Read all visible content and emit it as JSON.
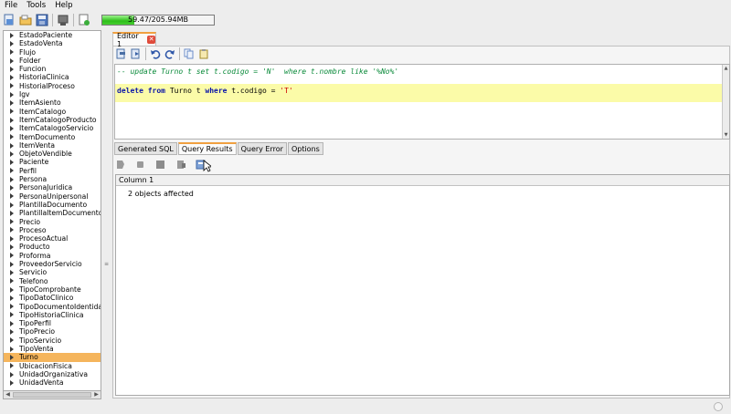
{
  "menu": [
    "File",
    "Tools",
    "Help"
  ],
  "toolbar": {
    "icons": [
      "new-icon",
      "open-icon",
      "save-icon",
      "tool-icon",
      "run-icon"
    ],
    "memory_label": "59.47/205.94MB",
    "memory_fraction": 0.29
  },
  "tree": {
    "items": [
      "EstadoPaciente",
      "EstadoVenta",
      "Flujo",
      "Folder",
      "Funcion",
      "HistoriaClinica",
      "HistorialProceso",
      "Igv",
      "ItemAsiento",
      "ItemCatalogo",
      "ItemCatalogoProducto",
      "ItemCatalogoServicio",
      "ItemDocumento",
      "ItemVenta",
      "ObjetoVendible",
      "Paciente",
      "Perfil",
      "Persona",
      "PersonaJuridica",
      "PersonaUnipersonal",
      "PlantillaDocumento",
      "PlantillaItemDocumento",
      "Precio",
      "Proceso",
      "ProcesoActual",
      "Producto",
      "Proforma",
      "ProveedorServicio",
      "Servicio",
      "Telefono",
      "TipoComprobante",
      "TipoDatoClinico",
      "TipoDocumentoIdentidad",
      "TipoHistoriaClinica",
      "TipoPerfil",
      "TipoPrecio",
      "TipoServicio",
      "TipoVenta",
      "Turno",
      "UbicacionFisica",
      "UnidadOrganizativa",
      "UnidadVenta"
    ],
    "selected": "Turno"
  },
  "editor": {
    "tab_label": "Editor 1",
    "comment_line": "-- update Turno t set t.codigo = 'N'  where t.nombre like '%No%'",
    "sql": {
      "kw1": "delete",
      "kw2": "from",
      "ident1": "Turno t",
      "kw3": "where",
      "ident2": "t.codigo =",
      "literal": "'T'"
    }
  },
  "bottom_tabs": [
    "Generated SQL",
    "Query Results",
    "Query Error",
    "Options"
  ],
  "active_bottom_tab": "Query Results",
  "results": {
    "column_header": "Column 1",
    "rows": [
      "2 objects affected"
    ]
  }
}
